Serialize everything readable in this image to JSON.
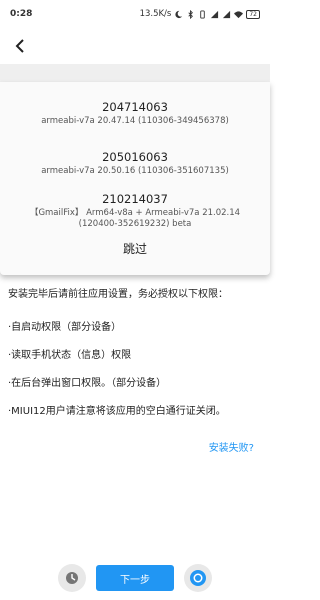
{
  "status_bar": {
    "time": "0:28",
    "net_speed": "13.5K/s",
    "battery": "72"
  },
  "popup": {
    "versions": [
      {
        "code": "204714063",
        "desc": "armeabi-v7a 20.47.14 (110306-349456378)",
        "desc2": ""
      },
      {
        "code": "205016063",
        "desc": "armeabi-v7a 20.50.16 (110306-351607135)",
        "desc2": ""
      },
      {
        "code": "210214037",
        "desc": "【GmailFix】 Arm64-v8a + Armeabi-v7a 21.02.14",
        "desc2": "(120400-352619232) beta"
      }
    ],
    "skip_label": "跳过"
  },
  "instructions": {
    "intro": "安装完毕后请前往应用设置，务必授权以下权限：",
    "items": [
      "·自启动权限（部分设备）",
      "·读取手机状态（信息）权限",
      "·在后台弹出窗口权限。（部分设备）",
      "·MIUI12用户请注意将该应用的空白通行证关闭。"
    ]
  },
  "install_failed_link": "安装失败?",
  "bottom": {
    "next_label": "下一步"
  },
  "colors": {
    "accent": "#2196f3"
  }
}
